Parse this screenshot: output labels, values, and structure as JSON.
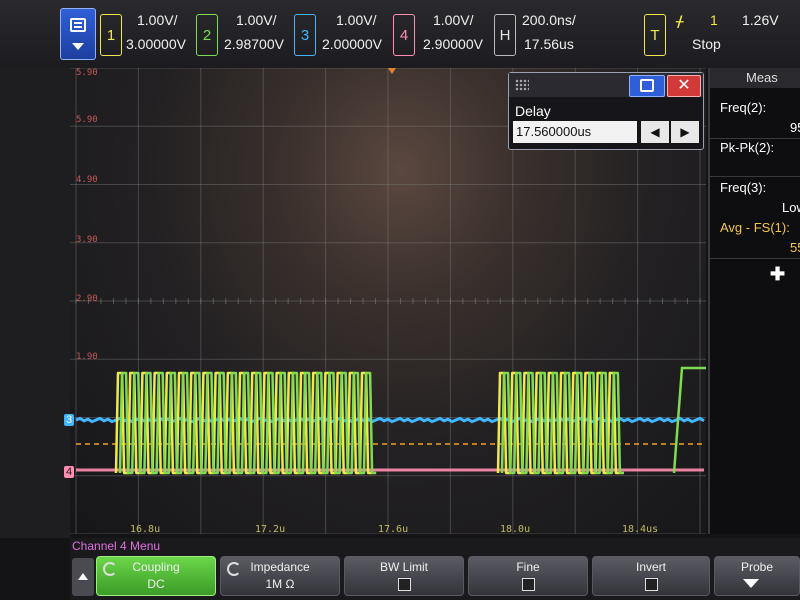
{
  "channels": [
    {
      "num": "1",
      "scale": "1.00V/",
      "offset": "3.00000V",
      "color": "#f2e84a"
    },
    {
      "num": "2",
      "scale": "1.00V/",
      "offset": "2.98700V",
      "color": "#7edb52"
    },
    {
      "num": "3",
      "scale": "1.00V/",
      "offset": "2.00000V",
      "color": "#3fb6ff"
    },
    {
      "num": "4",
      "scale": "1.00V/",
      "offset": "2.90000V",
      "color": "#ff8fb0"
    }
  ],
  "horizontal": {
    "label": "H",
    "scale": "200.0ns/",
    "delay": "17.56us"
  },
  "trigger": {
    "label": "T",
    "channel": "1",
    "level": "1.26V",
    "status": "Stop"
  },
  "delay_dialog": {
    "label": "Delay",
    "value": "17.560000us"
  },
  "measurements": {
    "title": "Meas",
    "items": [
      {
        "label": "Freq(2):",
        "value": "95",
        "color": "#ffffff"
      },
      {
        "label": "Pk-Pk(2):",
        "value": "",
        "color": "#ffffff"
      },
      {
        "label": "Freq(3):",
        "value": "Low",
        "color": "#ffffff"
      },
      {
        "label": "Avg - FS(1):",
        "value": "55",
        "color": "#f2c84a"
      }
    ]
  },
  "y_labels": [
    "5.90",
    "5.90",
    "4.90",
    "3.90",
    "2.90",
    "1.90"
  ],
  "x_labels": [
    "16.8u",
    "17.2u",
    "17.6u",
    "18.0u",
    "18.4us"
  ],
  "ground_markers": {
    "ch3": "3",
    "ch4": "4"
  },
  "channel_menu": "Channel 4 Menu",
  "softkeys": [
    {
      "title": "Coupling",
      "value": "DC"
    },
    {
      "title": "Impedance",
      "value": "1M Ω"
    },
    {
      "title": "BW Limit",
      "value": ""
    },
    {
      "title": "Fine",
      "value": ""
    },
    {
      "title": "Invert",
      "value": ""
    },
    {
      "title": "Probe",
      "value": ""
    }
  ],
  "waveforms": {
    "ch1_color": "#f2e84a",
    "ch2_color": "#7edb52",
    "ch3_color": "#3fb6ff",
    "ch4_color": "#ff8fb0",
    "avg_line_color": "#f2a020"
  }
}
